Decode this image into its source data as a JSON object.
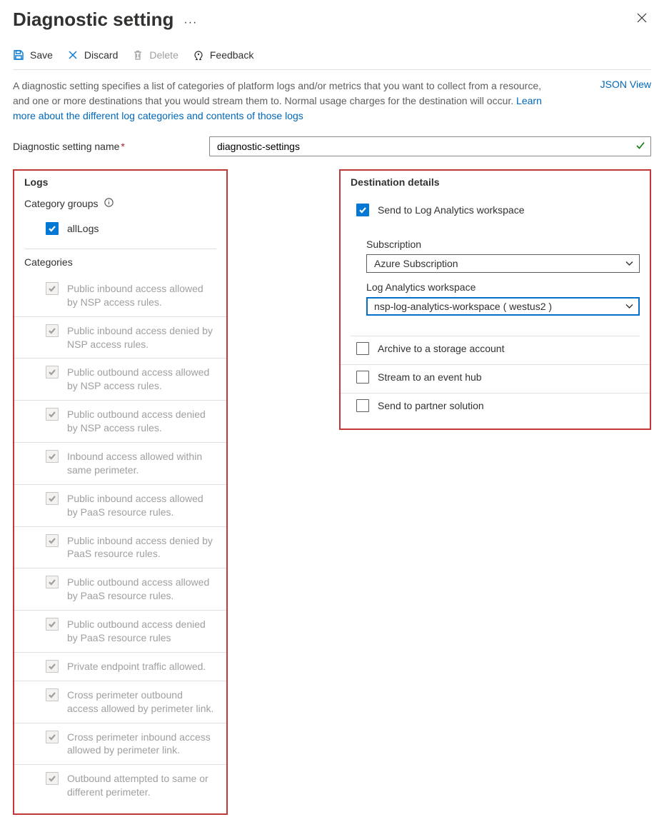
{
  "header": {
    "title": "Diagnostic setting"
  },
  "toolbar": {
    "save": "Save",
    "discard": "Discard",
    "delete": "Delete",
    "feedback": "Feedback"
  },
  "description": {
    "text": "A diagnostic setting specifies a list of categories of platform logs and/or metrics that you want to collect from a resource, and one or more destinations that you would stream them to. Normal usage charges for the destination will occur. ",
    "link": "Learn more about the different log categories and contents of those logs",
    "json_view": "JSON View"
  },
  "setting_name": {
    "label": "Diagnostic setting name",
    "value": "diagnostic-settings"
  },
  "logs": {
    "title": "Logs",
    "category_groups_heading": "Category groups",
    "allLogs_label": "allLogs",
    "categories_heading": "Categories",
    "categories": [
      "Public inbound access allowed by NSP access rules.",
      "Public inbound access denied by NSP access rules.",
      "Public outbound access allowed by NSP access rules.",
      "Public outbound access denied by NSP access rules.",
      "Inbound access allowed within same perimeter.",
      "Public inbound access allowed by PaaS resource rules.",
      "Public inbound access denied by PaaS resource rules.",
      "Public outbound access allowed by PaaS resource rules.",
      "Public outbound access denied by PaaS resource rules",
      "Private endpoint traffic allowed.",
      "Cross perimeter outbound access allowed by perimeter link.",
      "Cross perimeter inbound access allowed by perimeter link.",
      "Outbound attempted to same or different perimeter."
    ]
  },
  "destination": {
    "title": "Destination details",
    "send_la_label": "Send to Log Analytics workspace",
    "subscription_label": "Subscription",
    "subscription_value": "Azure Subscription",
    "workspace_label": "Log Analytics workspace",
    "workspace_value": "nsp-log-analytics-workspace ( westus2 )",
    "archive_label": "Archive to a storage account",
    "stream_label": "Stream to an event hub",
    "partner_label": "Send to partner solution"
  }
}
